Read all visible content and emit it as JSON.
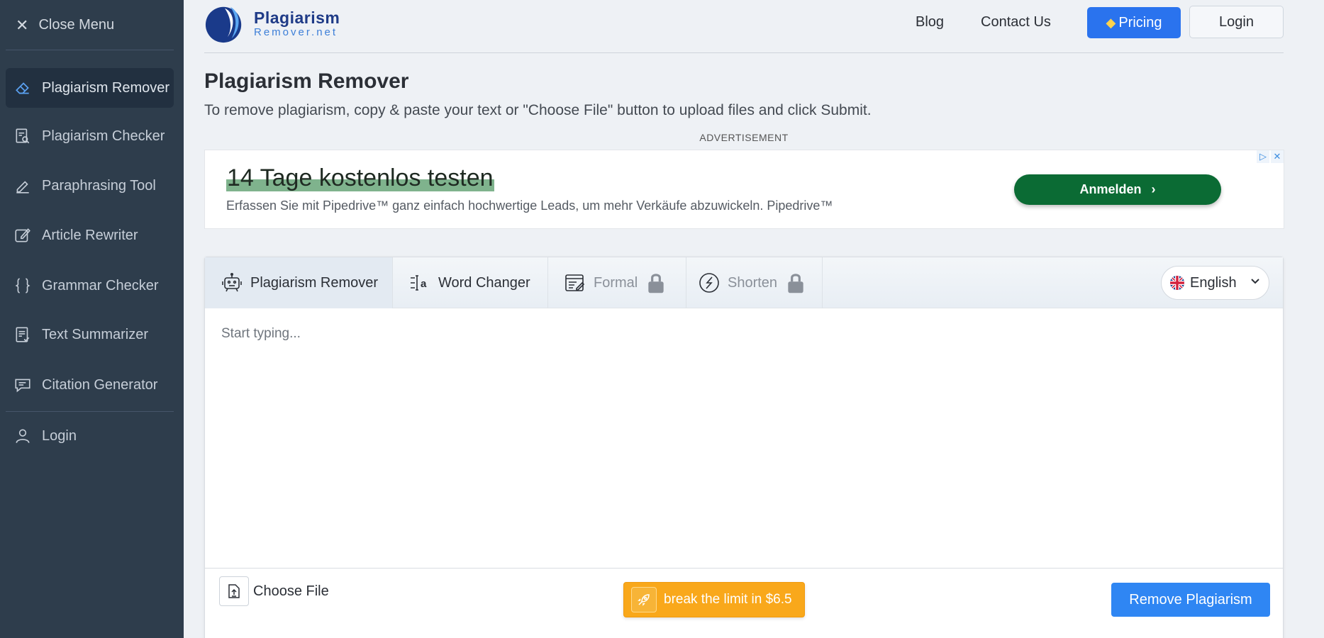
{
  "sidebar": {
    "close_label": "Close Menu",
    "items": [
      {
        "label": "Plagiarism Remover",
        "icon": "eraser-icon",
        "active": true
      },
      {
        "label": "Plagiarism Checker",
        "icon": "doc-search-icon"
      },
      {
        "label": "Paraphrasing Tool",
        "icon": "pen-icon"
      },
      {
        "label": "Article Rewriter",
        "icon": "edit-icon"
      },
      {
        "label": "Grammar Checker",
        "icon": "braces-icon"
      },
      {
        "label": "Text Summarizer",
        "icon": "doc-check-icon"
      },
      {
        "label": "Citation Generator",
        "icon": "quote-icon"
      }
    ],
    "login_label": "Login"
  },
  "header": {
    "logo_line1": "Plagiarism",
    "logo_line2": "Remover.net",
    "nav": [
      "Blog",
      "Contact Us"
    ],
    "pricing_label": "Pricing",
    "login_label": "Login"
  },
  "main": {
    "title": "Plagiarism Remover",
    "subtitle": "To remove plagiarism, copy & paste your text or \"Choose File\" button to upload files and click Submit.",
    "ad_label": "ADVERTISEMENT"
  },
  "ad": {
    "headline": "14 Tage kostenlos testen",
    "description": "Erfassen Sie mit Pipedrive™ ganz einfach hochwertige Leads, um mehr Verkäufe abzuwickeln. Pipedrive™",
    "button_label": "Anmelden",
    "accent": "#0b6b34"
  },
  "editor": {
    "tabs": [
      {
        "label": "Plagiarism Remover",
        "icon": "robot-icon",
        "active": true
      },
      {
        "label": "Word Changer",
        "icon": "text-cursor-icon"
      },
      {
        "label": "Formal",
        "icon": "formal-doc-icon",
        "locked": true
      },
      {
        "label": "Shorten",
        "icon": "shorten-icon",
        "locked": true
      }
    ],
    "language": "English",
    "placeholder": "Start typing...",
    "choose_file_label": "Choose File",
    "limit_label": "break the limit in $6.5",
    "submit_label": "Remove Plagiarism"
  },
  "colors": {
    "sidebar_bg": "#2e3d4c",
    "primary": "#2f86f3",
    "warning": "#f9a81b"
  }
}
